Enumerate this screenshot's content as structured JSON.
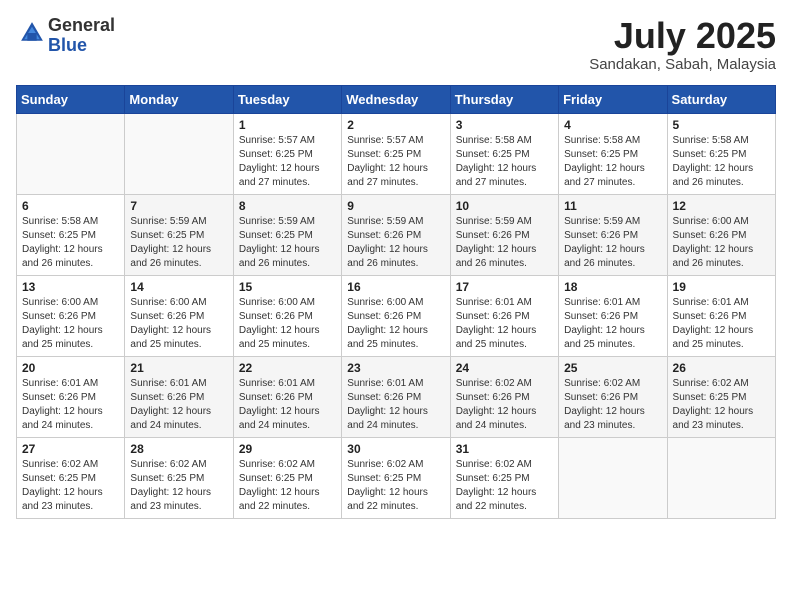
{
  "logo": {
    "general": "General",
    "blue": "Blue"
  },
  "header": {
    "month_year": "July 2025",
    "location": "Sandakan, Sabah, Malaysia"
  },
  "weekdays": [
    "Sunday",
    "Monday",
    "Tuesday",
    "Wednesday",
    "Thursday",
    "Friday",
    "Saturday"
  ],
  "weeks": [
    [
      {
        "day": "",
        "sunrise": "",
        "sunset": "",
        "daylight": ""
      },
      {
        "day": "",
        "sunrise": "",
        "sunset": "",
        "daylight": ""
      },
      {
        "day": "1",
        "sunrise": "Sunrise: 5:57 AM",
        "sunset": "Sunset: 6:25 PM",
        "daylight": "Daylight: 12 hours and 27 minutes."
      },
      {
        "day": "2",
        "sunrise": "Sunrise: 5:57 AM",
        "sunset": "Sunset: 6:25 PM",
        "daylight": "Daylight: 12 hours and 27 minutes."
      },
      {
        "day": "3",
        "sunrise": "Sunrise: 5:58 AM",
        "sunset": "Sunset: 6:25 PM",
        "daylight": "Daylight: 12 hours and 27 minutes."
      },
      {
        "day": "4",
        "sunrise": "Sunrise: 5:58 AM",
        "sunset": "Sunset: 6:25 PM",
        "daylight": "Daylight: 12 hours and 27 minutes."
      },
      {
        "day": "5",
        "sunrise": "Sunrise: 5:58 AM",
        "sunset": "Sunset: 6:25 PM",
        "daylight": "Daylight: 12 hours and 26 minutes."
      }
    ],
    [
      {
        "day": "6",
        "sunrise": "Sunrise: 5:58 AM",
        "sunset": "Sunset: 6:25 PM",
        "daylight": "Daylight: 12 hours and 26 minutes."
      },
      {
        "day": "7",
        "sunrise": "Sunrise: 5:59 AM",
        "sunset": "Sunset: 6:25 PM",
        "daylight": "Daylight: 12 hours and 26 minutes."
      },
      {
        "day": "8",
        "sunrise": "Sunrise: 5:59 AM",
        "sunset": "Sunset: 6:25 PM",
        "daylight": "Daylight: 12 hours and 26 minutes."
      },
      {
        "day": "9",
        "sunrise": "Sunrise: 5:59 AM",
        "sunset": "Sunset: 6:26 PM",
        "daylight": "Daylight: 12 hours and 26 minutes."
      },
      {
        "day": "10",
        "sunrise": "Sunrise: 5:59 AM",
        "sunset": "Sunset: 6:26 PM",
        "daylight": "Daylight: 12 hours and 26 minutes."
      },
      {
        "day": "11",
        "sunrise": "Sunrise: 5:59 AM",
        "sunset": "Sunset: 6:26 PM",
        "daylight": "Daylight: 12 hours and 26 minutes."
      },
      {
        "day": "12",
        "sunrise": "Sunrise: 6:00 AM",
        "sunset": "Sunset: 6:26 PM",
        "daylight": "Daylight: 12 hours and 26 minutes."
      }
    ],
    [
      {
        "day": "13",
        "sunrise": "Sunrise: 6:00 AM",
        "sunset": "Sunset: 6:26 PM",
        "daylight": "Daylight: 12 hours and 25 minutes."
      },
      {
        "day": "14",
        "sunrise": "Sunrise: 6:00 AM",
        "sunset": "Sunset: 6:26 PM",
        "daylight": "Daylight: 12 hours and 25 minutes."
      },
      {
        "day": "15",
        "sunrise": "Sunrise: 6:00 AM",
        "sunset": "Sunset: 6:26 PM",
        "daylight": "Daylight: 12 hours and 25 minutes."
      },
      {
        "day": "16",
        "sunrise": "Sunrise: 6:00 AM",
        "sunset": "Sunset: 6:26 PM",
        "daylight": "Daylight: 12 hours and 25 minutes."
      },
      {
        "day": "17",
        "sunrise": "Sunrise: 6:01 AM",
        "sunset": "Sunset: 6:26 PM",
        "daylight": "Daylight: 12 hours and 25 minutes."
      },
      {
        "day": "18",
        "sunrise": "Sunrise: 6:01 AM",
        "sunset": "Sunset: 6:26 PM",
        "daylight": "Daylight: 12 hours and 25 minutes."
      },
      {
        "day": "19",
        "sunrise": "Sunrise: 6:01 AM",
        "sunset": "Sunset: 6:26 PM",
        "daylight": "Daylight: 12 hours and 25 minutes."
      }
    ],
    [
      {
        "day": "20",
        "sunrise": "Sunrise: 6:01 AM",
        "sunset": "Sunset: 6:26 PM",
        "daylight": "Daylight: 12 hours and 24 minutes."
      },
      {
        "day": "21",
        "sunrise": "Sunrise: 6:01 AM",
        "sunset": "Sunset: 6:26 PM",
        "daylight": "Daylight: 12 hours and 24 minutes."
      },
      {
        "day": "22",
        "sunrise": "Sunrise: 6:01 AM",
        "sunset": "Sunset: 6:26 PM",
        "daylight": "Daylight: 12 hours and 24 minutes."
      },
      {
        "day": "23",
        "sunrise": "Sunrise: 6:01 AM",
        "sunset": "Sunset: 6:26 PM",
        "daylight": "Daylight: 12 hours and 24 minutes."
      },
      {
        "day": "24",
        "sunrise": "Sunrise: 6:02 AM",
        "sunset": "Sunset: 6:26 PM",
        "daylight": "Daylight: 12 hours and 24 minutes."
      },
      {
        "day": "25",
        "sunrise": "Sunrise: 6:02 AM",
        "sunset": "Sunset: 6:26 PM",
        "daylight": "Daylight: 12 hours and 23 minutes."
      },
      {
        "day": "26",
        "sunrise": "Sunrise: 6:02 AM",
        "sunset": "Sunset: 6:25 PM",
        "daylight": "Daylight: 12 hours and 23 minutes."
      }
    ],
    [
      {
        "day": "27",
        "sunrise": "Sunrise: 6:02 AM",
        "sunset": "Sunset: 6:25 PM",
        "daylight": "Daylight: 12 hours and 23 minutes."
      },
      {
        "day": "28",
        "sunrise": "Sunrise: 6:02 AM",
        "sunset": "Sunset: 6:25 PM",
        "daylight": "Daylight: 12 hours and 23 minutes."
      },
      {
        "day": "29",
        "sunrise": "Sunrise: 6:02 AM",
        "sunset": "Sunset: 6:25 PM",
        "daylight": "Daylight: 12 hours and 22 minutes."
      },
      {
        "day": "30",
        "sunrise": "Sunrise: 6:02 AM",
        "sunset": "Sunset: 6:25 PM",
        "daylight": "Daylight: 12 hours and 22 minutes."
      },
      {
        "day": "31",
        "sunrise": "Sunrise: 6:02 AM",
        "sunset": "Sunset: 6:25 PM",
        "daylight": "Daylight: 12 hours and 22 minutes."
      },
      {
        "day": "",
        "sunrise": "",
        "sunset": "",
        "daylight": ""
      },
      {
        "day": "",
        "sunrise": "",
        "sunset": "",
        "daylight": ""
      }
    ]
  ]
}
